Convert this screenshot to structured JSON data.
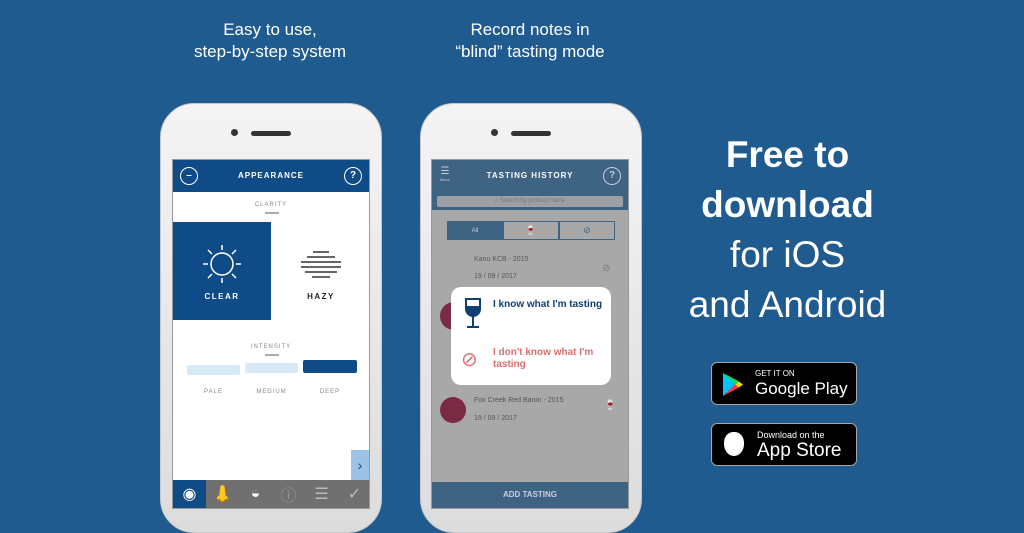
{
  "captions": {
    "left": [
      "Easy to use,",
      "step-by-step system"
    ],
    "middle": [
      "Record notes in",
      "“blind” tasting mode"
    ]
  },
  "headline": {
    "lines": [
      "Free to",
      "download",
      "for iOS",
      "and Android"
    ]
  },
  "appearance_screen": {
    "title": "APPEARANCE",
    "help": "?",
    "clarity_label": "CLARITY",
    "clarity_options": [
      {
        "label": "CLEAR",
        "selected": true,
        "icon": "sun-icon"
      },
      {
        "label": "HAZY",
        "selected": false,
        "icon": "haze-icon"
      }
    ],
    "intensity_label": "INTENSITY",
    "intensity_options": [
      "PALE",
      "MEDIUM",
      "DEEP"
    ],
    "intensity_selected": "DEEP",
    "next": "›",
    "bottom_tabs": [
      "eye-icon",
      "nose-icon",
      "mouth-icon",
      "info-icon",
      "menu-lines-icon",
      "check-icon"
    ]
  },
  "history_screen": {
    "menu_label": "Menu",
    "title": "TASTING HISTORY",
    "help": "?",
    "search_placeholder": "Search by product name",
    "filters": [
      "All",
      "wine-glass-icon",
      "eye-off-icon"
    ],
    "items": [
      {
        "name": "Kanu KCB - 2015",
        "date": "19 / 09 / 2017",
        "mode": "blind"
      },
      {
        "name": "Fox Creek Red Baron - 2015",
        "date": "19 / 09 / 2017",
        "mode": "known"
      }
    ],
    "popup": {
      "known": "I know what I'm tasting",
      "blind": "I don't know what I'm tasting"
    },
    "add_button": "ADD TASTING"
  },
  "badges": {
    "google": {
      "top": "GET IT ON",
      "main": "Google Play"
    },
    "apple": {
      "top": "Download on the",
      "main": "App Store"
    }
  },
  "colors": {
    "background": "#1f5b8f",
    "brand_blue": "#0f4c87",
    "wine": "#8b2f4b",
    "blind_red": "#d9706f"
  }
}
